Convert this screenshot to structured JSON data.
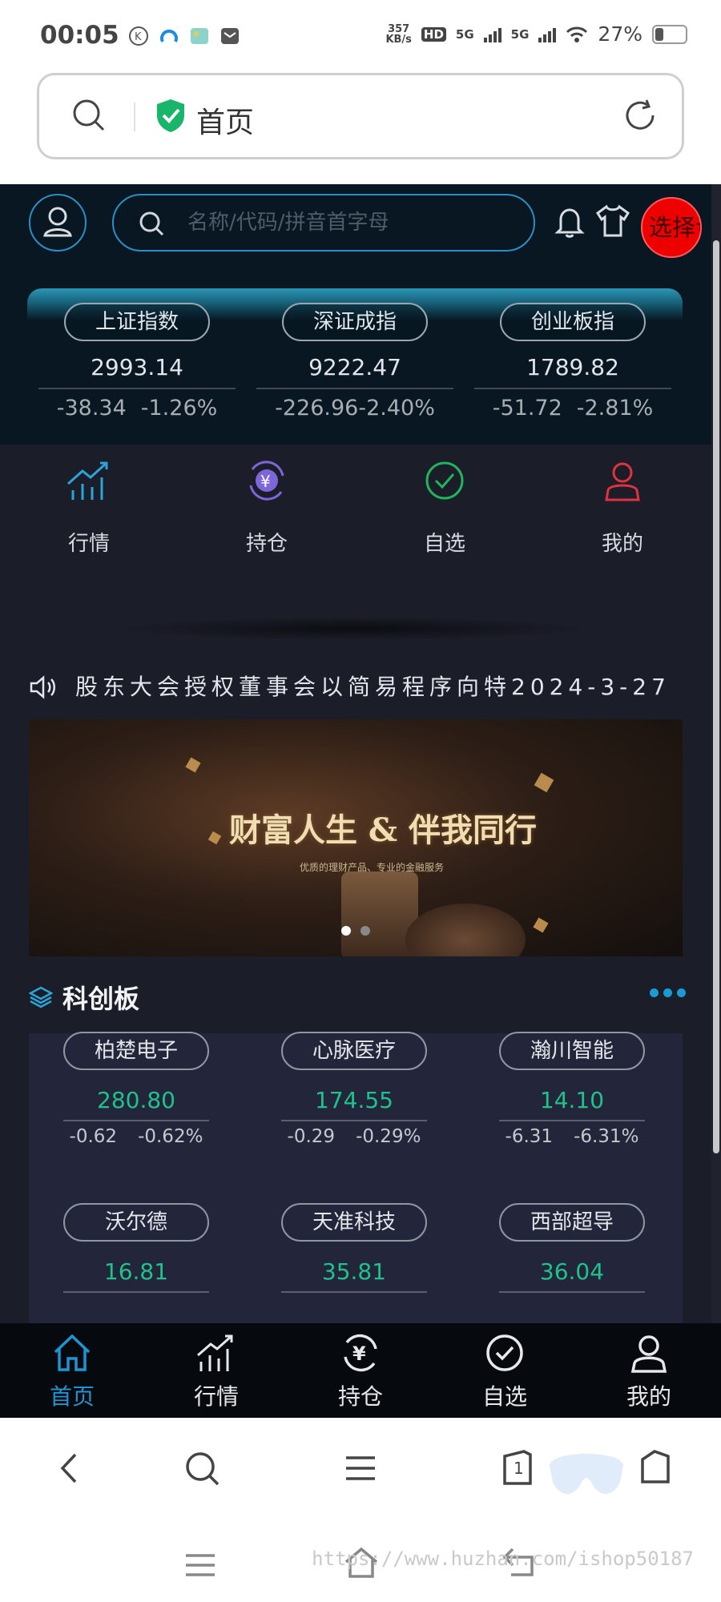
{
  "status_bar": {
    "time": "00:05",
    "net_speed_value": "357",
    "net_speed_unit": "KB/s",
    "hd_label": "HD",
    "signal1": "5G",
    "signal2": "5G",
    "battery": "27%",
    "battery_level": 0.27
  },
  "browser": {
    "page_title": "首页"
  },
  "header": {
    "search_placeholder": "名称/代码/拼音首字母",
    "select_button_label": "选择语"
  },
  "indices": [
    {
      "name": "上证指数",
      "value": "2993.14",
      "change": "-38.34",
      "percent": "-1.26%"
    },
    {
      "name": "深证成指",
      "value": "9222.47",
      "change": "-226.96",
      "percent": "-2.40%"
    },
    {
      "name": "创业板指",
      "value": "1789.82",
      "change": "-51.72",
      "percent": "-2.81%"
    }
  ],
  "quick_nav": [
    {
      "label": "行情",
      "icon": "chart-trend-icon"
    },
    {
      "label": "持仓",
      "icon": "yuan-cycle-icon"
    },
    {
      "label": "自选",
      "icon": "check-circle-icon"
    },
    {
      "label": "我的",
      "icon": "user-icon"
    }
  ],
  "notice": {
    "text": "股东大会授权董事会以简易程序向特2024-3-27"
  },
  "banner": {
    "slogan": "财富人生 & 伴我同行",
    "subtitle": "优质的理财产品、专业的金融服务"
  },
  "kcb": {
    "title": "科创板",
    "stocks": [
      {
        "name": "柏楚电子",
        "price": "280.80",
        "change": "-0.62",
        "percent": "-0.62%"
      },
      {
        "name": "心脉医疗",
        "price": "174.55",
        "change": "-0.29",
        "percent": "-0.29%"
      },
      {
        "name": "瀚川智能",
        "price": "14.10",
        "change": "-6.31",
        "percent": "-6.31%"
      },
      {
        "name": "沃尔德",
        "price": "16.81"
      },
      {
        "name": "天准科技",
        "price": "35.81"
      },
      {
        "name": "西部超导",
        "price": "36.04"
      }
    ]
  },
  "tab_bar": [
    {
      "label": "首页",
      "icon": "home-icon",
      "active": true
    },
    {
      "label": "行情",
      "icon": "chart-trend-icon"
    },
    {
      "label": "持仓",
      "icon": "yuan-cycle-icon"
    },
    {
      "label": "自选",
      "icon": "check-circle-icon"
    },
    {
      "label": "我的",
      "icon": "user-icon"
    }
  ],
  "browser_nav": {
    "tabs_count": "1"
  },
  "watermark": "https://www.huzhan.com/ishop50187",
  "colors": {
    "accent": "#1e95d2",
    "up_green": "#1fc28b",
    "alert_red": "#ee0000",
    "app_bg": "#1b1d28",
    "header_bg": "#081722"
  }
}
